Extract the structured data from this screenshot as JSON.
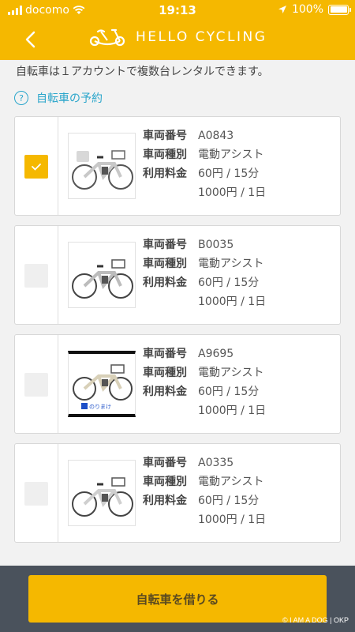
{
  "status": {
    "carrier": "docomo",
    "time": "19:13",
    "battery": "100%"
  },
  "header": {
    "title": "HELLO CYCLING"
  },
  "info": {
    "text": "自転車は１アカウントで複数台レンタルできます。",
    "reserve_link": "自転車の予約",
    "help_icon": "?"
  },
  "labels": {
    "number": "車両番号",
    "type": "車両種別",
    "fee": "利用料金"
  },
  "bikes": [
    {
      "number": "A0843",
      "type": "電動アシスト",
      "fee_short": "60円 / 15分",
      "fee_day": "1000円 / 1日",
      "selected": true
    },
    {
      "number": "B0035",
      "type": "電動アシスト",
      "fee_short": "60円 / 15分",
      "fee_day": "1000円 / 1日",
      "selected": false
    },
    {
      "number": "A9695",
      "type": "電動アシスト",
      "fee_short": "60円 / 15分",
      "fee_day": "1000円 / 1日",
      "selected": false,
      "logo_text": "のりまけ"
    },
    {
      "number": "A0335",
      "type": "電動アシスト",
      "fee_short": "60円 / 15分",
      "fee_day": "1000円 / 1日",
      "selected": false
    }
  ],
  "footer": {
    "rent_button": "自転車を借りる",
    "watermark": "© I AM A DOG | OKP"
  },
  "colors": {
    "accent": "#f5b800",
    "link": "#2ba6cb",
    "footer_bg": "#4a525c"
  }
}
